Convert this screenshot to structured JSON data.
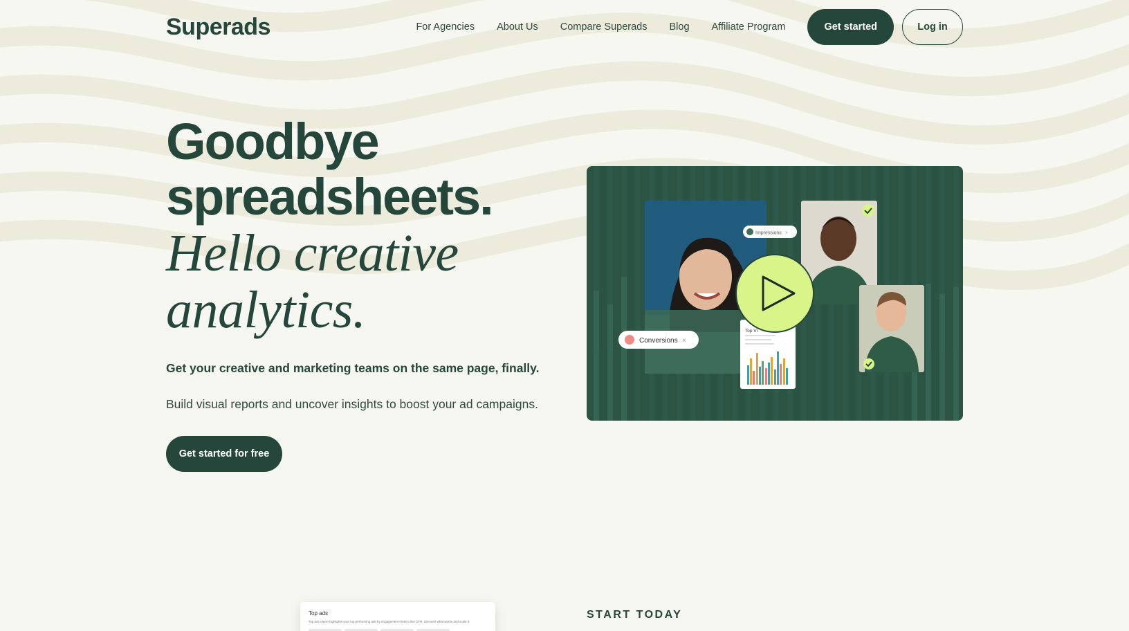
{
  "brand": {
    "logo": "Superads",
    "accent": "#25473b",
    "highlight": "#d9f58a",
    "background": "#f7f7f1"
  },
  "nav": {
    "links": [
      "For Agencies",
      "About Us",
      "Compare Superads",
      "Blog",
      "Affiliate Program"
    ],
    "get_started": "Get started",
    "log_in": "Log in"
  },
  "hero": {
    "line1": "Goodbye",
    "line2": "spreadsheets.",
    "line3": "Hello creative",
    "line4": "analytics.",
    "tagline": "Get your creative and marketing teams on the same page, finally.",
    "subtext": "Build visual reports and uncover insights to boost your ad campaigns.",
    "cta": "Get started for free"
  },
  "media": {
    "chip_impressions": "Impressions",
    "chip_conversions": "Conversions",
    "card_title": "Top Vi",
    "play_icon": "play-icon"
  },
  "preview": {
    "title": "Top ads",
    "description": "Top ads report highlights your top performing ads by engagement metrics like CTR. Discover what works and scale it."
  },
  "section": {
    "eyebrow": "START TODAY"
  }
}
